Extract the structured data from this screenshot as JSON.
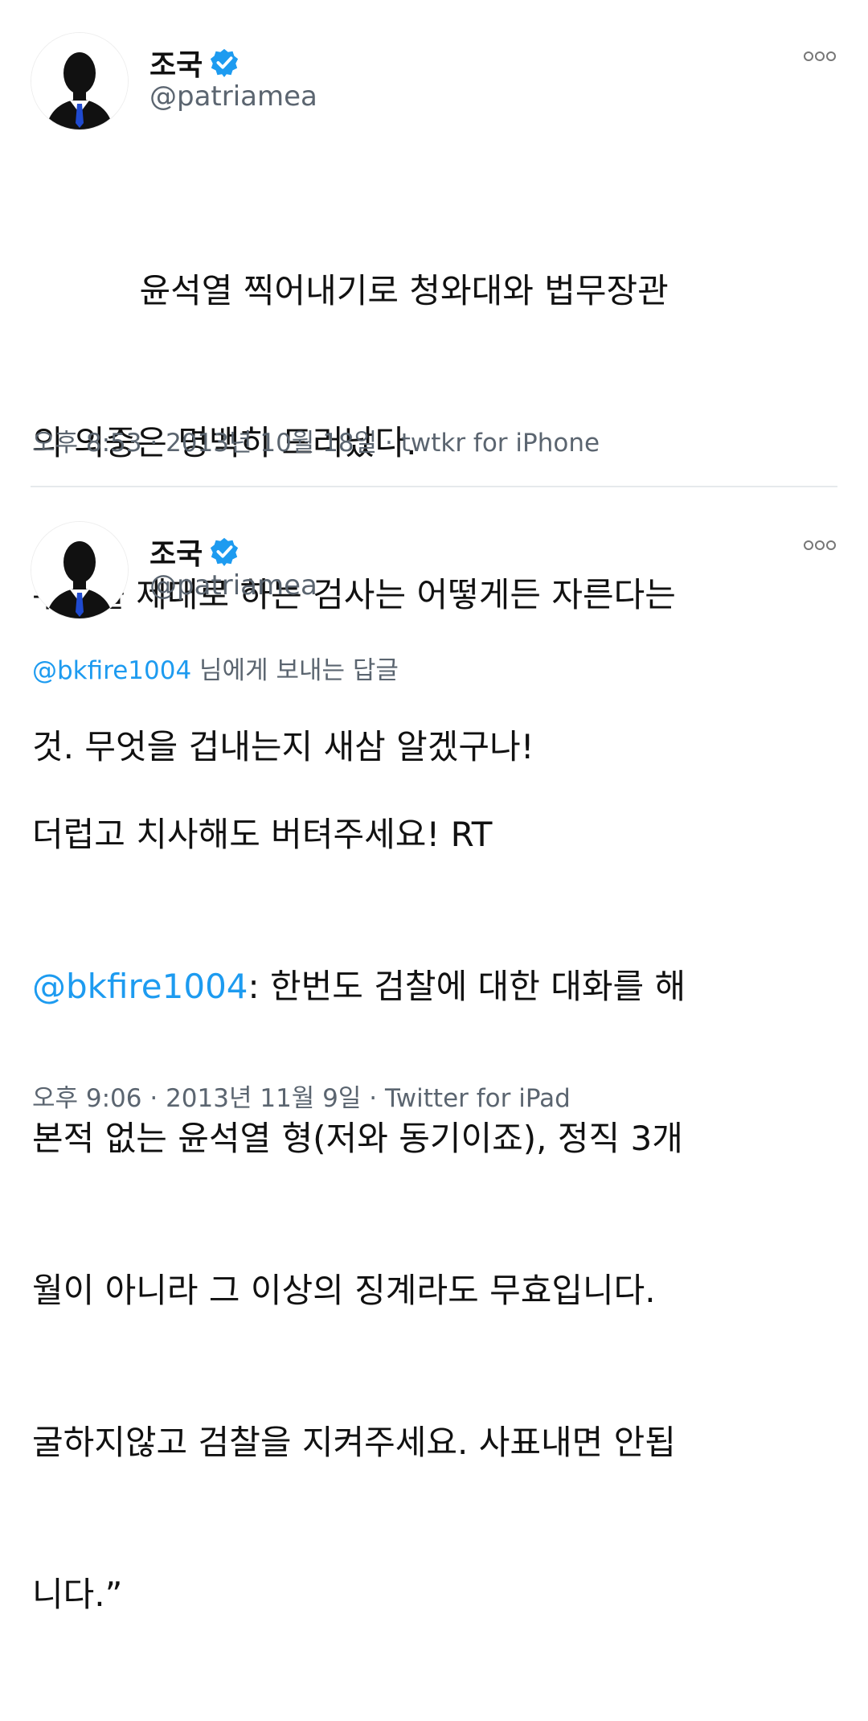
{
  "tweets": [
    {
      "author_name": "조국",
      "author_handle": "@patriamea",
      "verified": true,
      "avatar_icon": "user-silhouette-suit-icon",
      "more_icon": "more-options-icon",
      "body_lines": [
        "          윤석열 찍어내기로 청와대와 법무장관",
        "의 의중은 명백히 드러났다.",
        "수사를 제대로 하는 검사는 어떻게든 자른다는",
        "것. 무엇을 겁내는지 새삼 알겠구나!"
      ],
      "time": "오후 8:53",
      "date": "2013년 10월 18일",
      "source": "twtkr for iPhone"
    },
    {
      "author_name": "조국",
      "author_handle": "@patriamea",
      "verified": true,
      "avatar_icon": "user-silhouette-suit-icon",
      "more_icon": "more-options-icon",
      "reply_mention": "@bkfire1004",
      "reply_suffix": " 님에게 보내는 답글",
      "body_line1": "더럽고 치사해도 버텨주세요! RT",
      "body_mention": "@bkfire1004",
      "body_line2_rest": ": 한번도 검찰에 대한 대화를 해",
      "body_lines_rest": [
        "본적 없는 윤석열 형(저와 동기이죠), 정직 3개",
        "월이 아니라 그 이상의 징계라도 무효입니다.",
        "굴하지않고 검찰을 지켜주세요. 사표내면 안됩",
        "니다.”"
      ],
      "time": "오후 9:06",
      "date": "2013년 11월 9일",
      "source": "Twitter for iPad"
    }
  ],
  "meta_separator": " · ",
  "colors": {
    "mention": "#1d9bf0",
    "verified": "#1d9bf0",
    "secondary_text": "#5b6570",
    "divider": "#e6e9ec"
  }
}
